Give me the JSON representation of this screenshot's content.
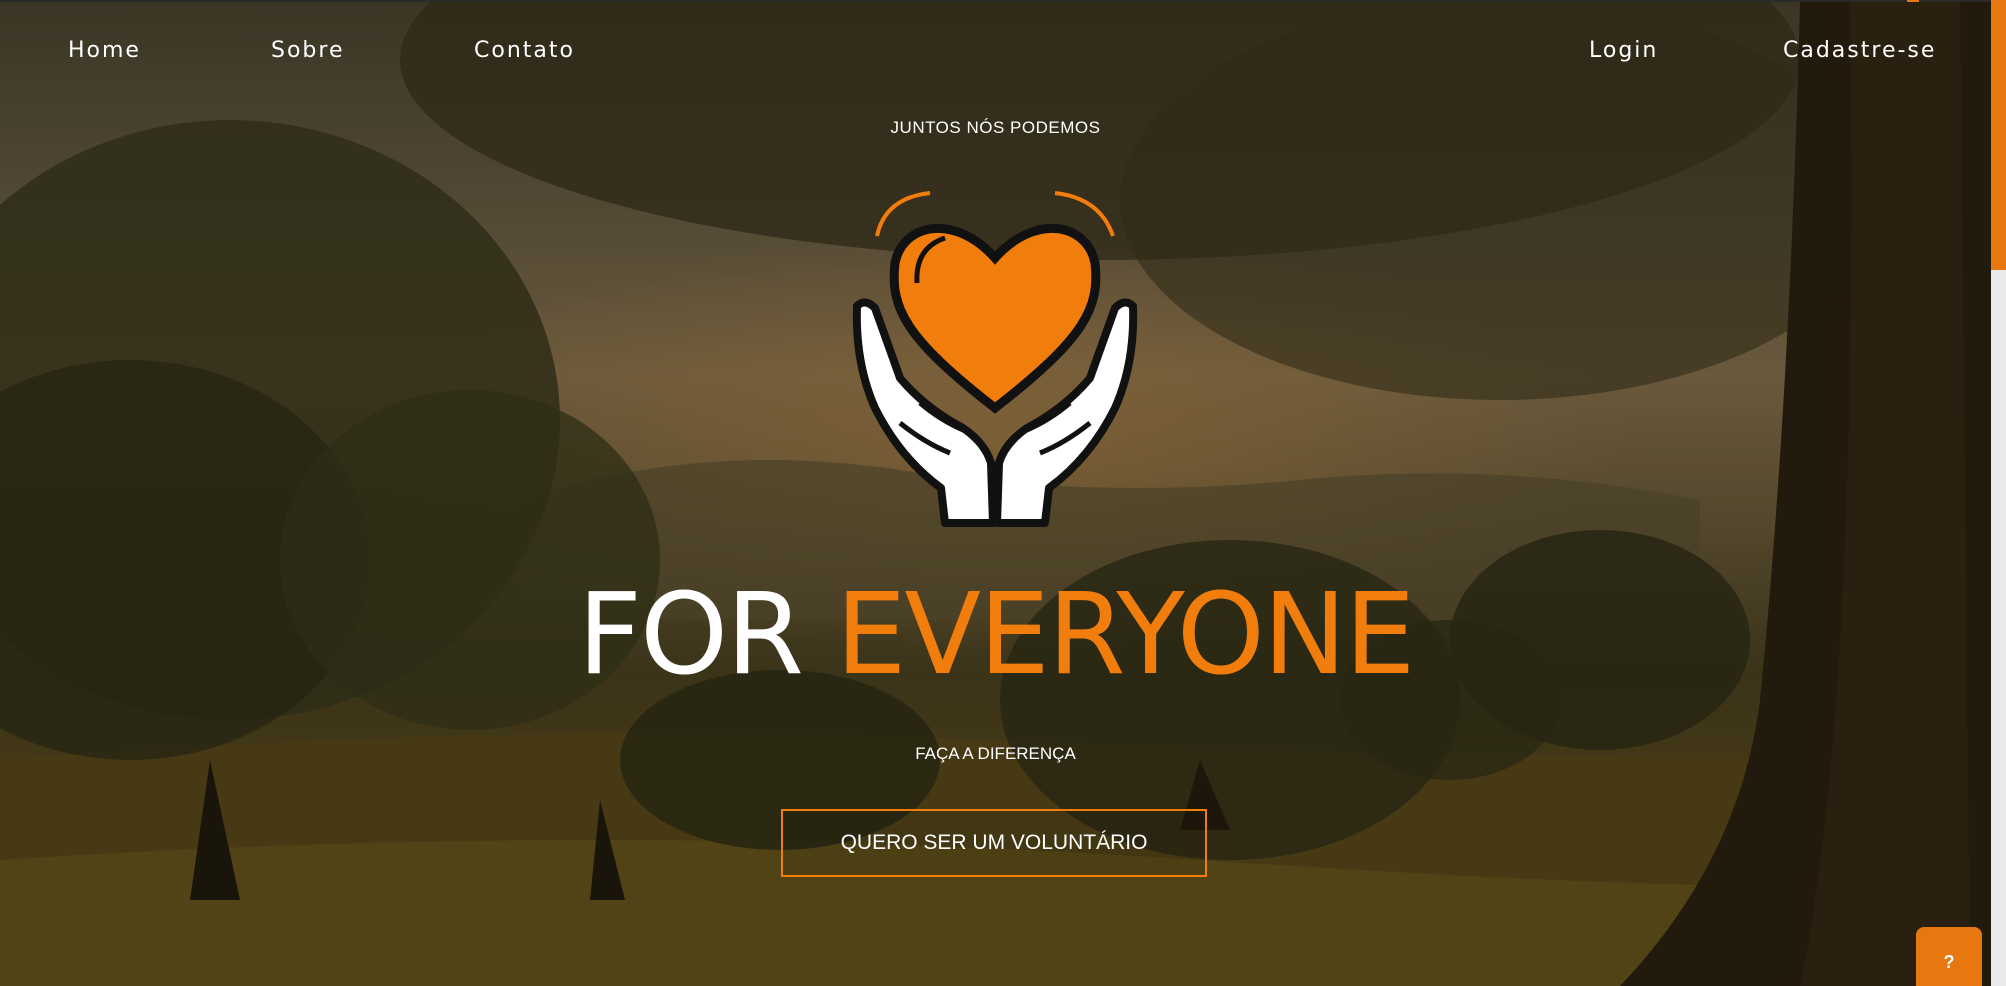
{
  "nav": {
    "left": [
      {
        "label": "Home"
      },
      {
        "label": "Sobre"
      },
      {
        "label": "Contato"
      }
    ],
    "right": [
      {
        "label": "Login"
      },
      {
        "label": "Cadastre-se"
      }
    ]
  },
  "hero": {
    "eyebrow": "JUNTOS NÓS PODEMOS",
    "brand_white": "FOR",
    "brand_orange": "EVERYONE",
    "subtitle": "FAÇA A DIFERENÇA",
    "cta_label": "QUERO SER UM VOLUNTÁRIO"
  },
  "help_button": {
    "label": "?"
  },
  "colors": {
    "accent": "#f07d0c",
    "text": "#ffffff"
  },
  "icons": {
    "logo": "heart-in-hands-icon",
    "help": "question-icon"
  }
}
